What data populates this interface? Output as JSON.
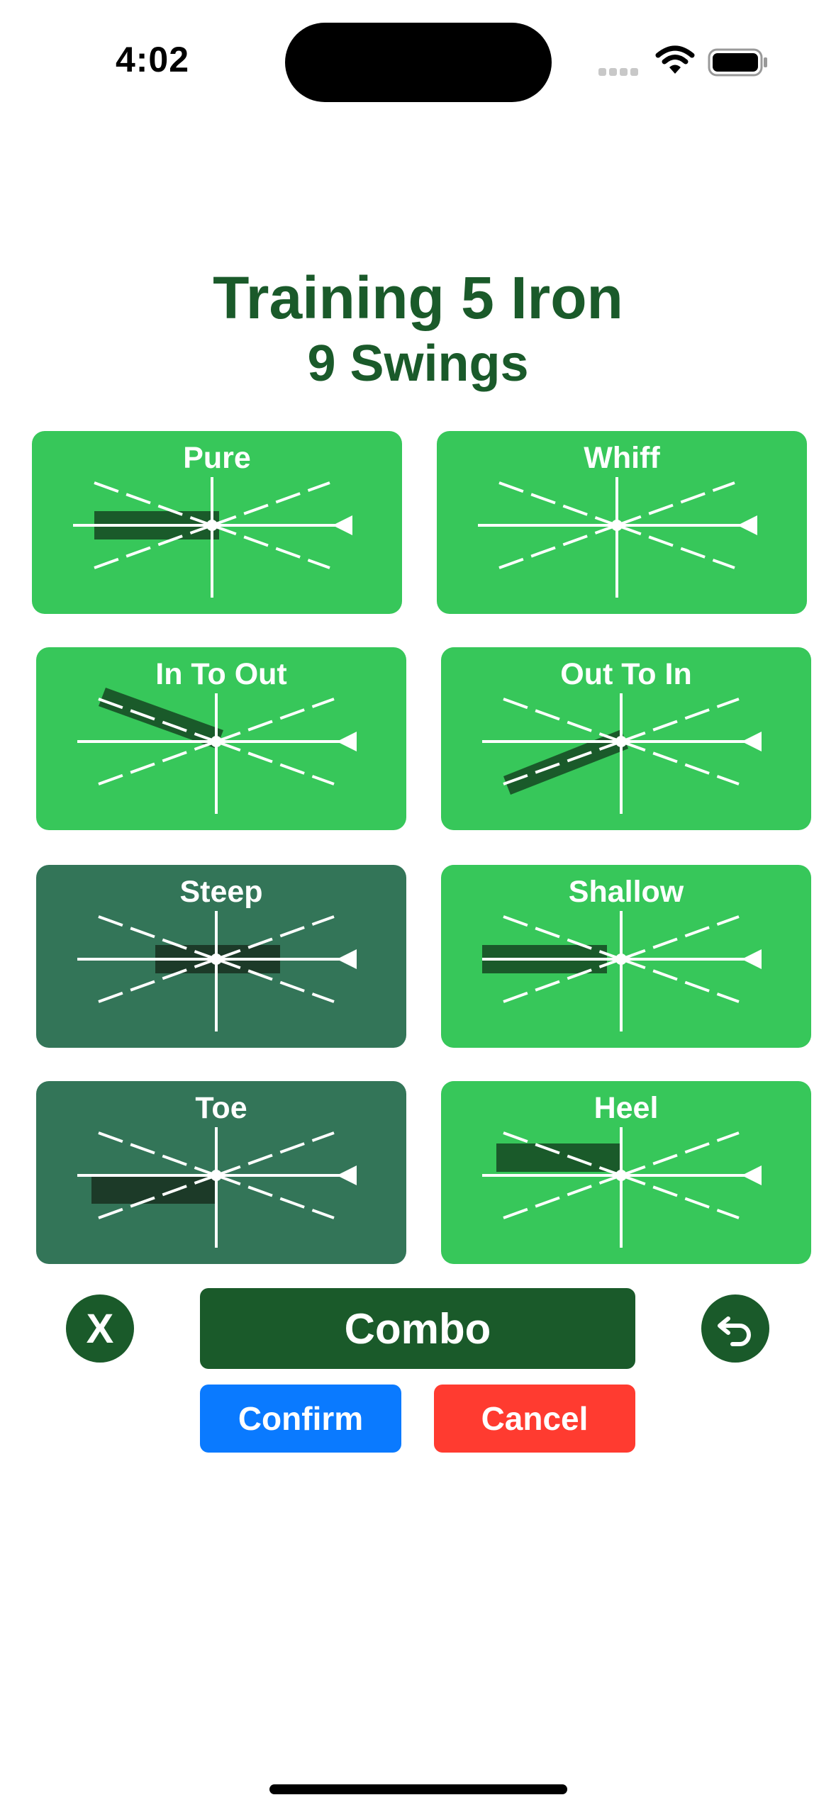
{
  "status_bar": {
    "time": "4:02"
  },
  "header": {
    "title": "Training 5 Iron",
    "subtitle": "9 Swings"
  },
  "cards": [
    {
      "label": "Pure",
      "selected": false,
      "pattern": "pure"
    },
    {
      "label": "Whiff",
      "selected": false,
      "pattern": "none"
    },
    {
      "label": "In To Out",
      "selected": false,
      "pattern": "in-to-out"
    },
    {
      "label": "Out To In",
      "selected": false,
      "pattern": "out-to-in"
    },
    {
      "label": "Steep",
      "selected": true,
      "pattern": "steep"
    },
    {
      "label": "Shallow",
      "selected": false,
      "pattern": "shallow"
    },
    {
      "label": "Toe",
      "selected": true,
      "pattern": "toe"
    },
    {
      "label": "Heel",
      "selected": false,
      "pattern": "heel"
    }
  ],
  "actions": {
    "clear_label": "X",
    "combo_label": "Combo",
    "confirm_label": "Confirm",
    "cancel_label": "Cancel",
    "undo_icon": "undo-arrow-icon"
  },
  "colors": {
    "card_green": "#37c75a",
    "card_selected": "#337558",
    "dark_green": "#1a5a2a",
    "confirm_blue": "#0a7aff",
    "cancel_red": "#ff3b30"
  }
}
